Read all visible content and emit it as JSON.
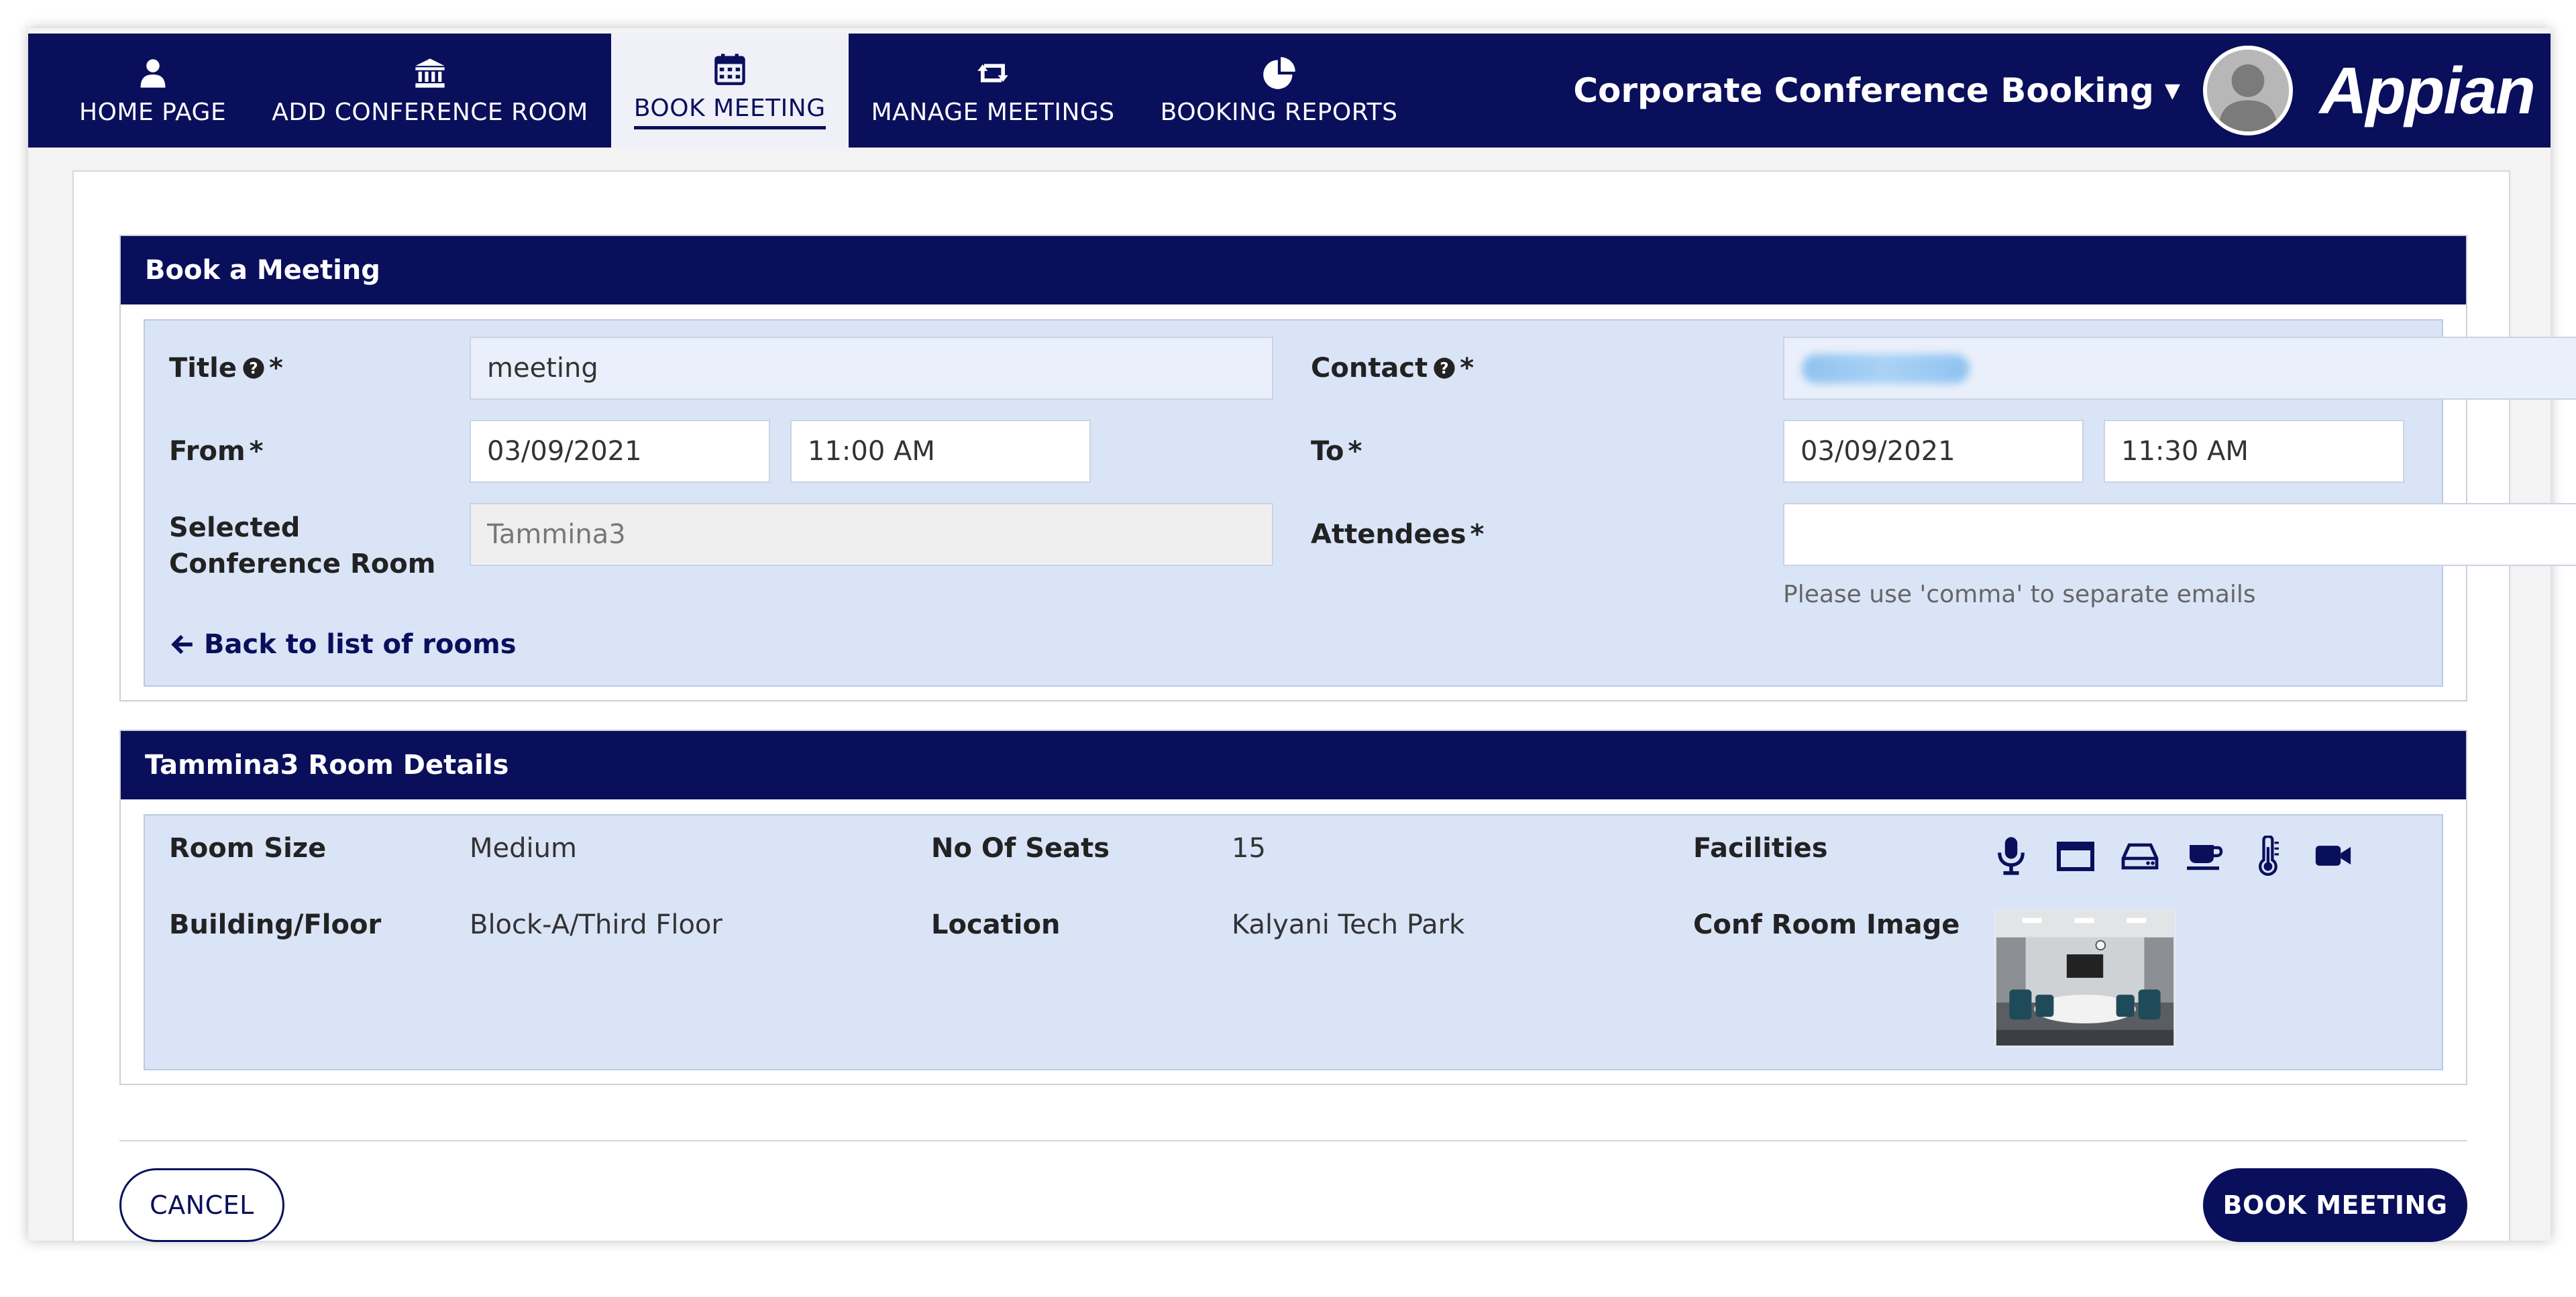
{
  "nav": {
    "items": [
      {
        "label": "HOME PAGE",
        "icon": "user-icon"
      },
      {
        "label": "ADD CONFERENCE ROOM",
        "icon": "bank-icon"
      },
      {
        "label": "BOOK MEETING",
        "icon": "calendar-icon",
        "active": true
      },
      {
        "label": "MANAGE MEETINGS",
        "icon": "retweet-icon"
      },
      {
        "label": "BOOKING REPORTS",
        "icon": "pie-chart-icon"
      }
    ]
  },
  "header": {
    "site_title": "Corporate Conference Booking",
    "brand": "Appian"
  },
  "book_meeting": {
    "heading": "Book a Meeting",
    "title_label": "Title",
    "title_value": "meeting",
    "contact_label": "Contact",
    "from_label": "From",
    "from_date": "03/09/2021",
    "from_time": "11:00 AM",
    "to_label": "To",
    "to_date": "03/09/2021",
    "to_time": "11:30 AM",
    "selected_room_label": "Selected Conference Room",
    "selected_room_value": "Tammina3",
    "attendees_label": "Attendees",
    "attendees_value": "",
    "attendees_hint": "Please use 'comma' to separate emails",
    "back_link": "Back to list of rooms",
    "required_mark": "*"
  },
  "room_details": {
    "heading": "Tammina3 Room Details",
    "room_size_label": "Room Size",
    "room_size_value": "Medium",
    "seats_label": "No Of Seats",
    "seats_value": "15",
    "facilities_label": "Facilities",
    "facilities": [
      "microphone-icon",
      "projector-screen-icon",
      "hard-drive-icon",
      "coffee-icon",
      "thermometer-icon",
      "video-camera-icon"
    ],
    "building_label": "Building/Floor",
    "building_value": "Block-A/Third Floor",
    "location_label": "Location",
    "location_value": "Kalyani Tech Park",
    "image_label": "Conf Room Image"
  },
  "actions": {
    "cancel": "CANCEL",
    "book": "BOOK MEETING"
  },
  "colors": {
    "primary": "#0a0f5c",
    "panel": "#d9e4f7"
  }
}
